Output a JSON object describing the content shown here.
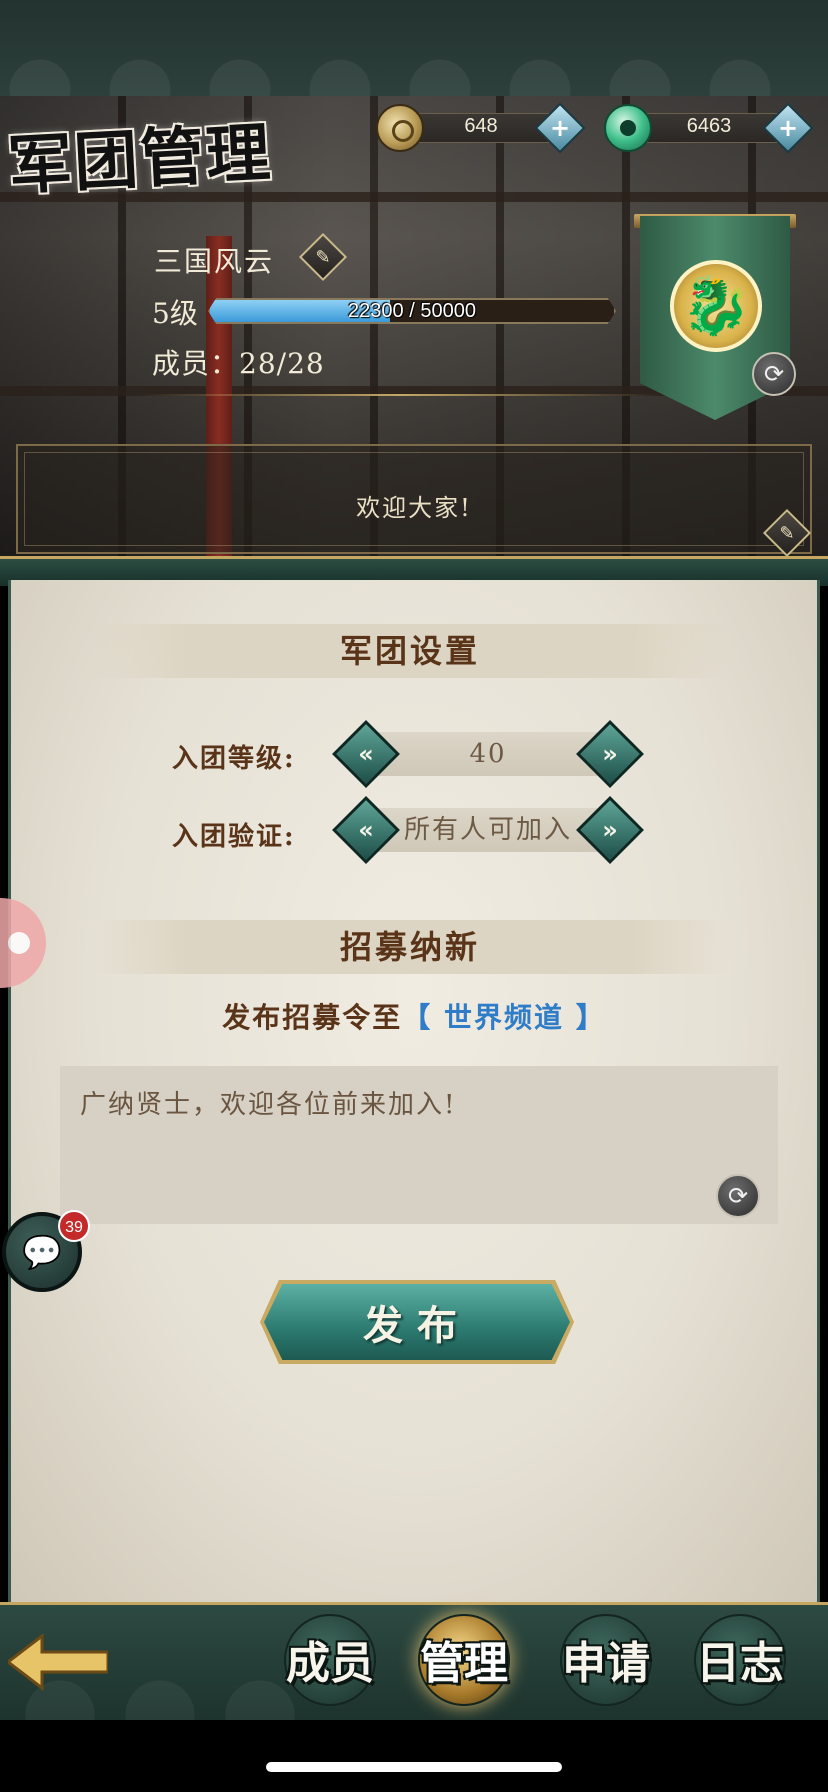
{
  "header": {
    "title": "军团管理",
    "currency": [
      {
        "name": "coin",
        "value": "648",
        "icon": "coin-icon"
      },
      {
        "name": "jade",
        "value": "6463",
        "icon": "jade-icon"
      }
    ],
    "add_label": "+"
  },
  "guild": {
    "name": "三国风云",
    "level_label": "5级",
    "xp_text": "22300 / 50000",
    "xp_fraction": 0.446,
    "members_text": "成员：28/28",
    "notice": "欢迎大家!"
  },
  "settings": {
    "section_title": "军团设置",
    "join_level_label": "入团等级:",
    "join_level_value": "40",
    "join_verify_label": "入团验证:",
    "join_verify_value": "所有人可加入"
  },
  "recruit": {
    "section_title": "招募纳新",
    "publish_prefix": "发布招募令至",
    "channel": "【 世界频道 】",
    "message": "广纳贤士，欢迎各位前来加入!",
    "publish_button": "发布"
  },
  "chat": {
    "badge": "39"
  },
  "nav": {
    "tabs": [
      {
        "label": "成员",
        "active": false
      },
      {
        "label": "管理",
        "active": true
      },
      {
        "label": "申请",
        "active": false
      },
      {
        "label": "日志",
        "active": false
      }
    ]
  },
  "icons": {
    "edit": "pencil-icon",
    "refresh": "refresh-icon",
    "emblem": "dragon-emblem-icon",
    "left_arrow": "chevron-left-icon",
    "right_arrow": "chevron-right-icon",
    "chat": "chat-bubble-icon",
    "back": "back-arrow-icon"
  },
  "colors": {
    "accent_teal": "#2c7a70",
    "xp_blue": "#3a9ad8",
    "text_brown": "#5a3418",
    "channel_blue": "#2f7cc8",
    "badge_red": "#c42a2a"
  }
}
